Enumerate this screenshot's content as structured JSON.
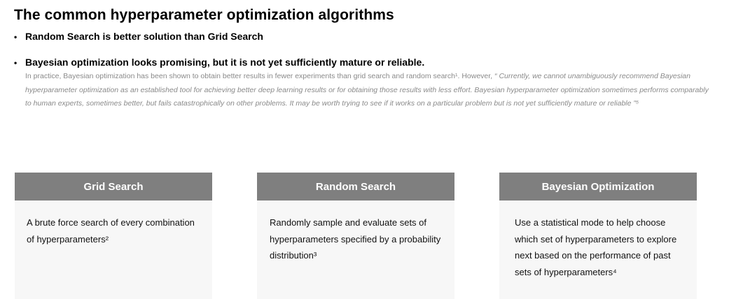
{
  "title": "The common hyperparameter optimization algorithms",
  "bullets": [
    {
      "marker": "•",
      "text": "Random Search is better solution than Grid Search"
    },
    {
      "marker": "•",
      "text": "Bayesian optimization looks promising, but it is not yet sufficiently mature or reliable."
    }
  ],
  "note": {
    "plain": "In practice, Bayesian optimization has been shown to obtain better results in fewer experiments than grid search and random search¹. However, ",
    "quote": "“ Currently, we cannot unambiguously recommend Bayesian hyperparameter optimization as an established tool for achieving better deep learning results or for obtaining those results with less effort. Bayesian hyperparameter optimization sometimes performs comparably to human experts, sometimes better, but fails catastrophically on other problems. It may be worth trying to see if it works on a particular problem but is not yet sufficiently mature or reliable ”⁵"
  },
  "cards": [
    {
      "heading": "Grid Search",
      "body": "A brute force search of every combination of hyperparameters²"
    },
    {
      "heading": "Random Search",
      "body": "Randomly sample and evaluate sets of hyperparameters specified by a probability distribution³"
    },
    {
      "heading": "Bayesian Optimization",
      "body": "Use a statistical mode to help choose which set of hyperparameters to explore next based on the performance of past sets of hyperparameters⁴"
    }
  ],
  "colors": {
    "card_header": "#7f7f7f",
    "card_body": "#f7f7f7",
    "note_text": "#8a8a8a"
  }
}
